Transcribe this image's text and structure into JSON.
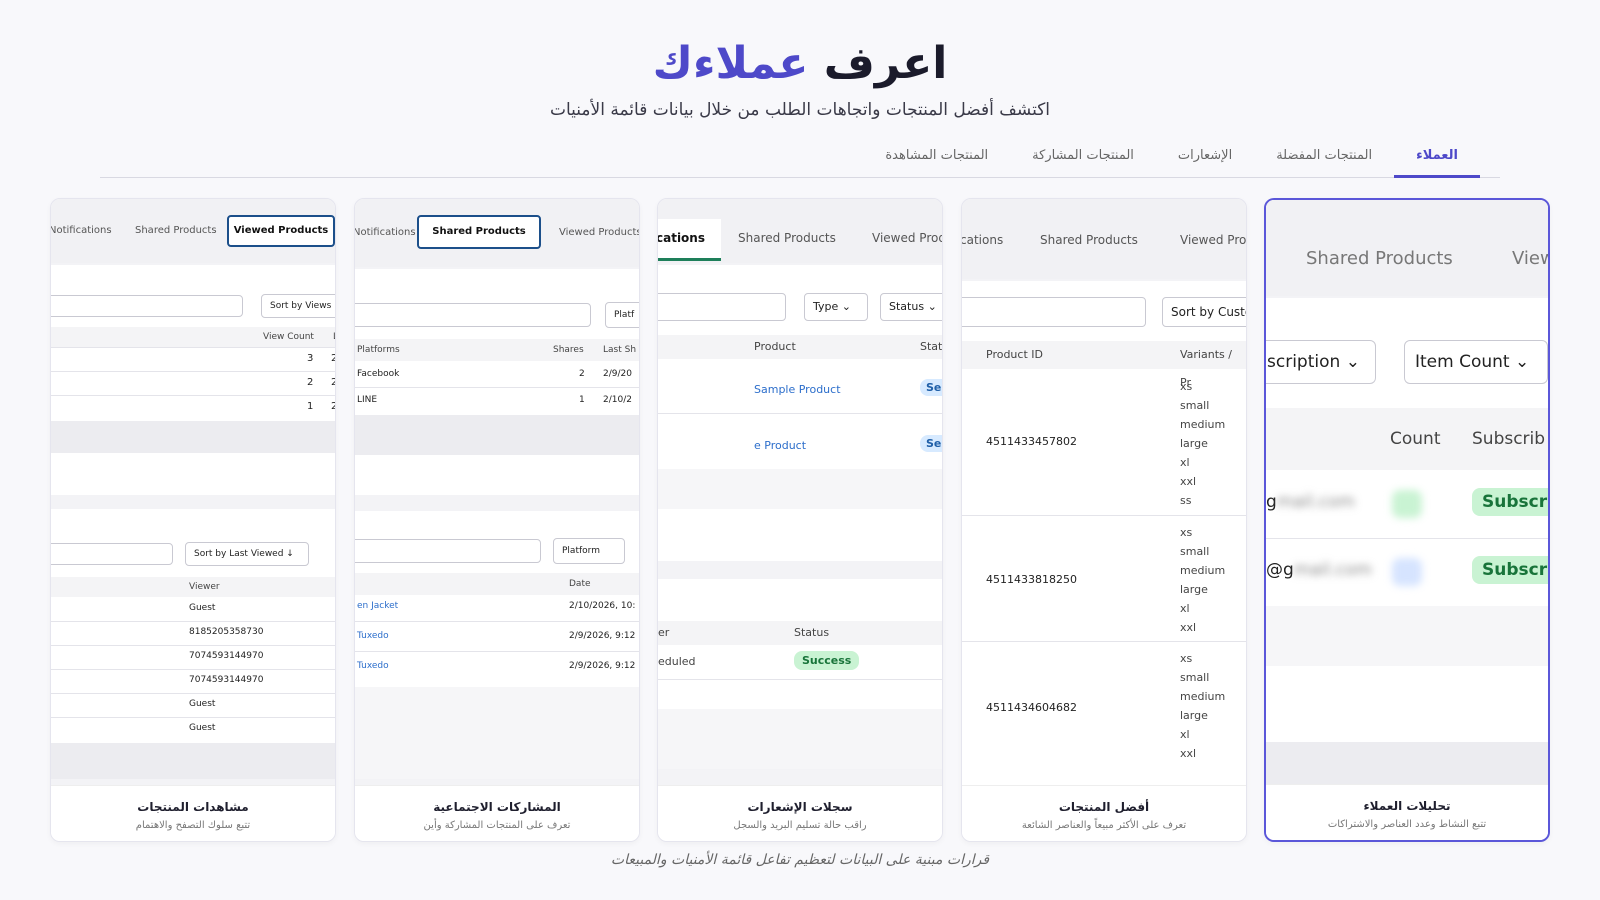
{
  "hero": {
    "title_part1": "اعرف ",
    "title_part2": "عملاءك",
    "subtitle": "اكتشف أفضل المنتجات واتجاهات الطلب من خلال بيانات قائمة الأمنيات"
  },
  "tabs": [
    "العملاء",
    "المنتجات المفضلة",
    "الإشعارات",
    "المنتجات المشاركة",
    "المنتجات المشاهدة"
  ],
  "cards": {
    "viewed": {
      "tabs": [
        "Notifications",
        "Shared Products",
        "Viewed Products"
      ],
      "sort_views": "Sort by Views ↓",
      "header_viewcount": "View Count",
      "header_l": "L",
      "counts": [
        "3",
        "2",
        "1"
      ],
      "trail": [
        "2",
        "2",
        "2"
      ],
      "sort_last": "Sort by Last Viewed ↓",
      "header_viewer": "Viewer",
      "viewers": [
        "Guest",
        "8185205358730",
        "7074593144970",
        "7074593144970",
        "Guest",
        "Guest"
      ],
      "title": "مشاهدات المنتجات",
      "subtitle": "تتبع سلوك التصفح والاهتمام"
    },
    "shared": {
      "tabs": [
        "Notifications",
        "Shared Products",
        "Viewed Products"
      ],
      "btn_platform_top": "Platf",
      "header_platforms": "Platforms",
      "header_shares": "Shares",
      "header_last": "Last Sh",
      "rows": [
        {
          "platform": "Facebook",
          "shares": "2",
          "last": "2/9/20"
        },
        {
          "platform": "LINE",
          "shares": "1",
          "last": "2/10/2"
        }
      ],
      "btn_platform": "Platform",
      "header_date": "Date",
      "rows2": [
        {
          "product": "en Jacket",
          "date": "2/10/2026, 10:"
        },
        {
          "product": "Tuxedo",
          "date": "2/9/2026, 9:12"
        },
        {
          "product": "Tuxedo",
          "date": "2/9/2026, 9:12"
        }
      ],
      "title": "المشاركات الاجتماعية",
      "subtitle": "تعرف على المنتجات المشاركة وأين"
    },
    "notif": {
      "tabs": [
        "cations",
        "Shared Products",
        "Viewed Prod"
      ],
      "btn_type": "Type",
      "btn_status": "Status",
      "header_product": "Product",
      "header_status": "Statu",
      "products": [
        "Sample Product",
        "e Product"
      ],
      "status_pill": "Ser",
      "header_er": "er",
      "header_status2": "Status",
      "eduled": "eduled",
      "success": "Success",
      "title": "سجلات الإشعارات",
      "subtitle": "راقب حالة تسليم البريد والسجل"
    },
    "top": {
      "tabs": [
        "cations",
        "Shared Products",
        "Viewed Pro"
      ],
      "sort": "Sort by Custo",
      "header_id": "Product ID",
      "header_variants": "Variants / Pr",
      "rows": [
        {
          "id": "4511433457802",
          "variants": [
            "xs",
            "small",
            "medium",
            "large",
            "xl",
            "xxl",
            "ss"
          ]
        },
        {
          "id": "4511433818250",
          "variants": [
            "xs",
            "small",
            "medium",
            "large",
            "xl",
            "xxl"
          ]
        },
        {
          "id": "4511434604682",
          "variants": [
            "xs",
            "small",
            "medium",
            "large",
            "xl",
            "xxl"
          ]
        }
      ],
      "title": "أفضل المنتجات",
      "subtitle": "تعرف على الأكثر مبيعاً والعناصر الشائعة"
    },
    "customers": {
      "tabs": [
        "Shared Products",
        "View"
      ],
      "btn_sub": "scription",
      "btn_item": "Item Count",
      "header_count": "Count",
      "header_sub": "Subscrib",
      "emails": [
        "g",
        "@g"
      ],
      "sub_pill": "Subscri",
      "title": "تحليلات العملاء",
      "subtitle": "تتبع النشاط وعدد العناصر والاشتراكات"
    }
  },
  "footer": "قرارات مبنية على البيانات لتعظيم تفاعل قائمة الأمنيات والمبيعات"
}
